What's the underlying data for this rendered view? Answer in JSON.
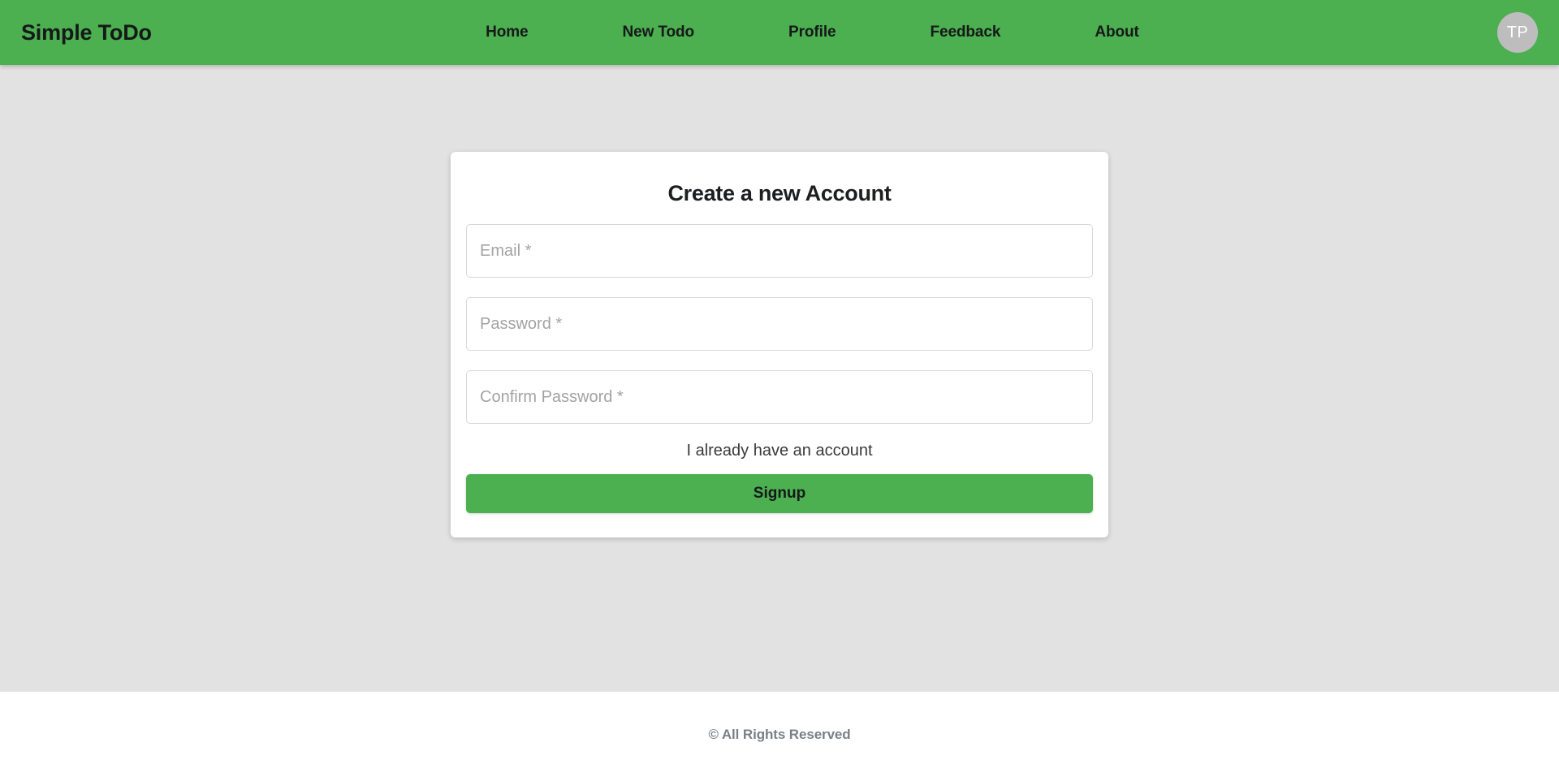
{
  "header": {
    "brand": "Simple ToDo",
    "nav_items": [
      {
        "label": "Home"
      },
      {
        "label": "New Todo"
      },
      {
        "label": "Profile"
      },
      {
        "label": "Feedback"
      },
      {
        "label": "About"
      }
    ],
    "avatar": {
      "initials": "TP",
      "bg_color": "#bdbdbd",
      "text_color": "#ffffff"
    },
    "bg_color": "#4CAF50",
    "text_color": "#16181a"
  },
  "main": {
    "bg_color": "#e2e2e2",
    "card": {
      "title": "Create a new Account",
      "fields": [
        {
          "name": "email",
          "placeholder": "Email *",
          "value": "",
          "type": "email"
        },
        {
          "name": "password",
          "placeholder": "Password *",
          "value": "",
          "type": "password"
        },
        {
          "name": "confirm_password",
          "placeholder": "Confirm Password *",
          "value": "",
          "type": "password"
        }
      ],
      "already_account_link": "I already have an account",
      "submit_label": "Signup",
      "submit_color": "#4CAF50"
    }
  },
  "footer": {
    "text": "© All Rights Reserved",
    "text_color": "#7b7f87",
    "bg_color": "#ffffff"
  }
}
